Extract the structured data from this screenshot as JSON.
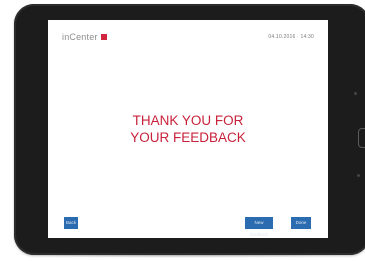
{
  "app": {
    "logo_text": "inCenter",
    "datetime": "04.10.2016 · 14:30"
  },
  "main": {
    "message_line1": "THANK YOU FOR",
    "message_line2": "YOUR FEEDBACK"
  },
  "footer": {
    "back_label": "Back",
    "feedback_label": "New feedback",
    "next_label": "Done"
  },
  "colors": {
    "accent": "#c8223b",
    "button": "#2b6cb0",
    "device": "#1c1c1c"
  },
  "icons": [
    "logo-mark-icon",
    "home-button-icon",
    "camera-icon",
    "sensor-icon"
  ]
}
